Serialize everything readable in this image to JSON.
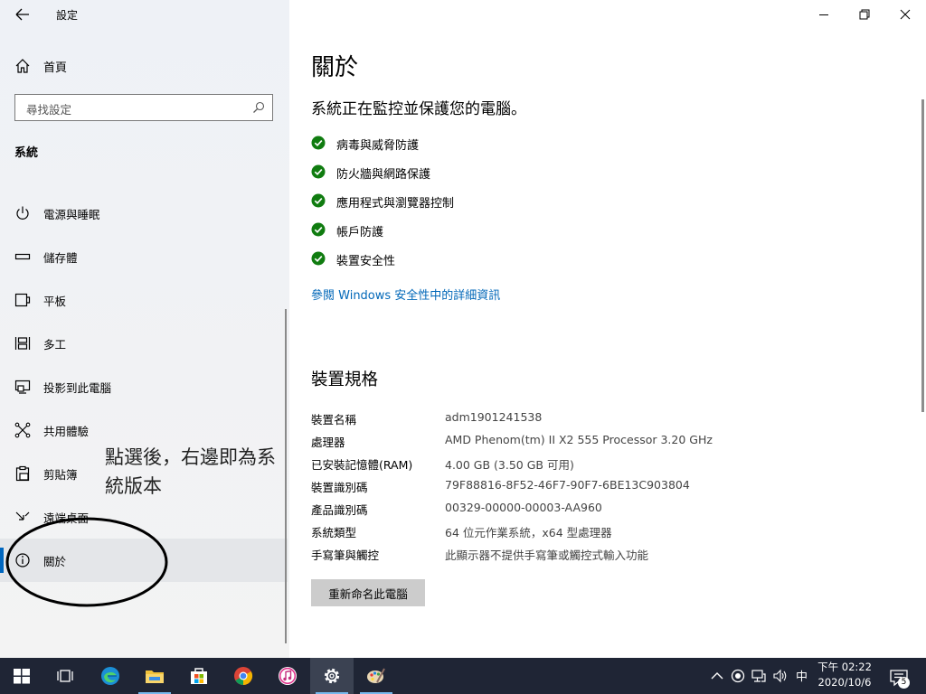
{
  "window": {
    "title": "設定"
  },
  "sidebar": {
    "home_label": "首頁",
    "search_placeholder": "尋找設定",
    "section_header": "系統",
    "items": [
      {
        "label": "電源與睡眠",
        "icon": "power-icon"
      },
      {
        "label": "儲存體",
        "icon": "storage-icon"
      },
      {
        "label": "平板",
        "icon": "tablet-icon"
      },
      {
        "label": "多工",
        "icon": "multitasking-icon"
      },
      {
        "label": "投影到此電腦",
        "icon": "projecting-icon"
      },
      {
        "label": "共用體驗",
        "icon": "shared-experiences-icon"
      },
      {
        "label": "剪貼簿",
        "icon": "clipboard-icon"
      },
      {
        "label": "遠端桌面",
        "icon": "remote-desktop-icon"
      },
      {
        "label": "關於",
        "icon": "info-icon",
        "selected": true
      }
    ],
    "annotation": "點選後，右邊即為系統版本"
  },
  "main": {
    "title": "關於",
    "status_message": "系統正在監控並保護您的電腦。",
    "protections": [
      {
        "label": "病毒與威脅防護"
      },
      {
        "label": "防火牆與網路保護"
      },
      {
        "label": "應用程式與瀏覽器控制"
      },
      {
        "label": "帳戶防護"
      },
      {
        "label": "裝置安全性"
      }
    ],
    "security_link": "參閱 Windows 安全性中的詳細資訊",
    "specs_title": "裝置規格",
    "specs": [
      {
        "key": "裝置名稱",
        "value": "adm1901241538"
      },
      {
        "key": "處理器",
        "value": "AMD Phenom(tm) II X2 555 Processor   3.20 GHz"
      },
      {
        "key": "已安裝記憶體(RAM)",
        "value": "4.00 GB (3.50 GB 可用)"
      },
      {
        "key": "裝置識別碼",
        "value": "79F88816-8F52-46F7-90F7-6BE13C903804"
      },
      {
        "key": "產品識別碼",
        "value": "00329-00000-00003-AA960"
      },
      {
        "key": "系統類型",
        "value": "64 位元作業系統，x64 型處理器"
      },
      {
        "key": "手寫筆與觸控",
        "value": "此顯示器不提供手寫筆或觸控式輸入功能"
      }
    ],
    "rename_button": "重新命名此電腦"
  },
  "taskbar": {
    "apps": [
      "start-icon",
      "task-view-icon",
      "edge-icon",
      "file-explorer-icon",
      "store-icon",
      "chrome-icon",
      "itunes-icon",
      "settings-icon",
      "paint-icon"
    ],
    "ime": "中",
    "time": "下午 02:22",
    "date": "2020/10/6",
    "notifications": "5"
  },
  "colors": {
    "accent": "#0067c0",
    "link": "#0067b8",
    "check": "#107c10",
    "taskbar": "#1f2535"
  }
}
